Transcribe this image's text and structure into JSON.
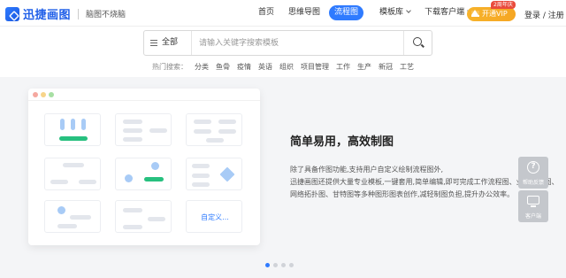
{
  "brand": {
    "name": "迅捷画图",
    "slogan": "脑图不烧脑"
  },
  "nav": {
    "items": [
      {
        "label": "首页",
        "active": false,
        "dropdown": false
      },
      {
        "label": "思维导图",
        "active": false,
        "dropdown": false
      },
      {
        "label": "流程图",
        "active": true,
        "dropdown": false
      },
      {
        "label": "模板库",
        "active": false,
        "dropdown": true
      },
      {
        "label": "下载客户端",
        "active": false,
        "dropdown": true
      }
    ],
    "vip_label": "开通VIP",
    "vip_badge": "2周年庆",
    "login_label": "登录 / 注册"
  },
  "search": {
    "scope": "全部",
    "placeholder": "请输入关键字搜索模板",
    "value": ""
  },
  "hot": {
    "label": "热门搜索：",
    "tags": [
      "分类",
      "鱼骨",
      "疫情",
      "英语",
      "组织",
      "项目管理",
      "工作",
      "生产",
      "新冠",
      "工艺"
    ]
  },
  "illustration": {
    "custom_label": "自定义..."
  },
  "feature": {
    "headline": "简单易用，高效制图",
    "lines": [
      "除了具备作图功能,支持用户自定义绘制流程图外,",
      "迅捷画图还提供大量专业模板,一键套用,简单编辑,即可完成工作流程图、业务流程图、",
      "网络拓扑图、甘特图等多种图形图表创作,减轻制图负担,提升办公效率。"
    ]
  },
  "side": {
    "help_label": "帮助反馈",
    "client_label": "客户端"
  },
  "pager": {
    "count": 4,
    "active": 1
  },
  "colors": {
    "accent": "#2f7bff",
    "vip": "#f5a623",
    "green": "#27c07f"
  },
  "icons": {
    "help": "question-circle-icon",
    "client": "monitor-icon",
    "search": "search-icon",
    "menu": "menu-icon"
  }
}
